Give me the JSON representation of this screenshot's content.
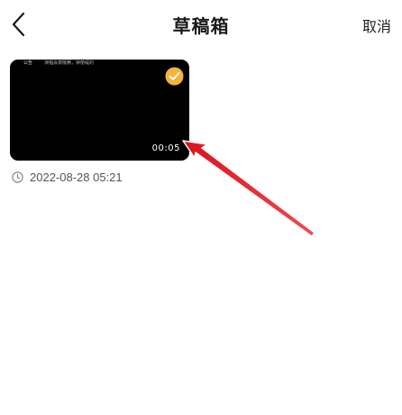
{
  "header": {
    "title": "草稿箱",
    "cancel_label": "取消",
    "back_icon": "chevron-left-icon"
  },
  "draft": {
    "notice_tag": "公告",
    "notice_text": "演唱会萧敬腾，钟丽缇的",
    "duration": "00:05",
    "selected": true,
    "selected_color": "#f5b33a",
    "date": "2022-08-28 05:21",
    "date_icon": "clock-icon"
  },
  "annotation": {
    "arrow_color": "#e2202a",
    "arrow_icon": "red-arrow-icon"
  }
}
